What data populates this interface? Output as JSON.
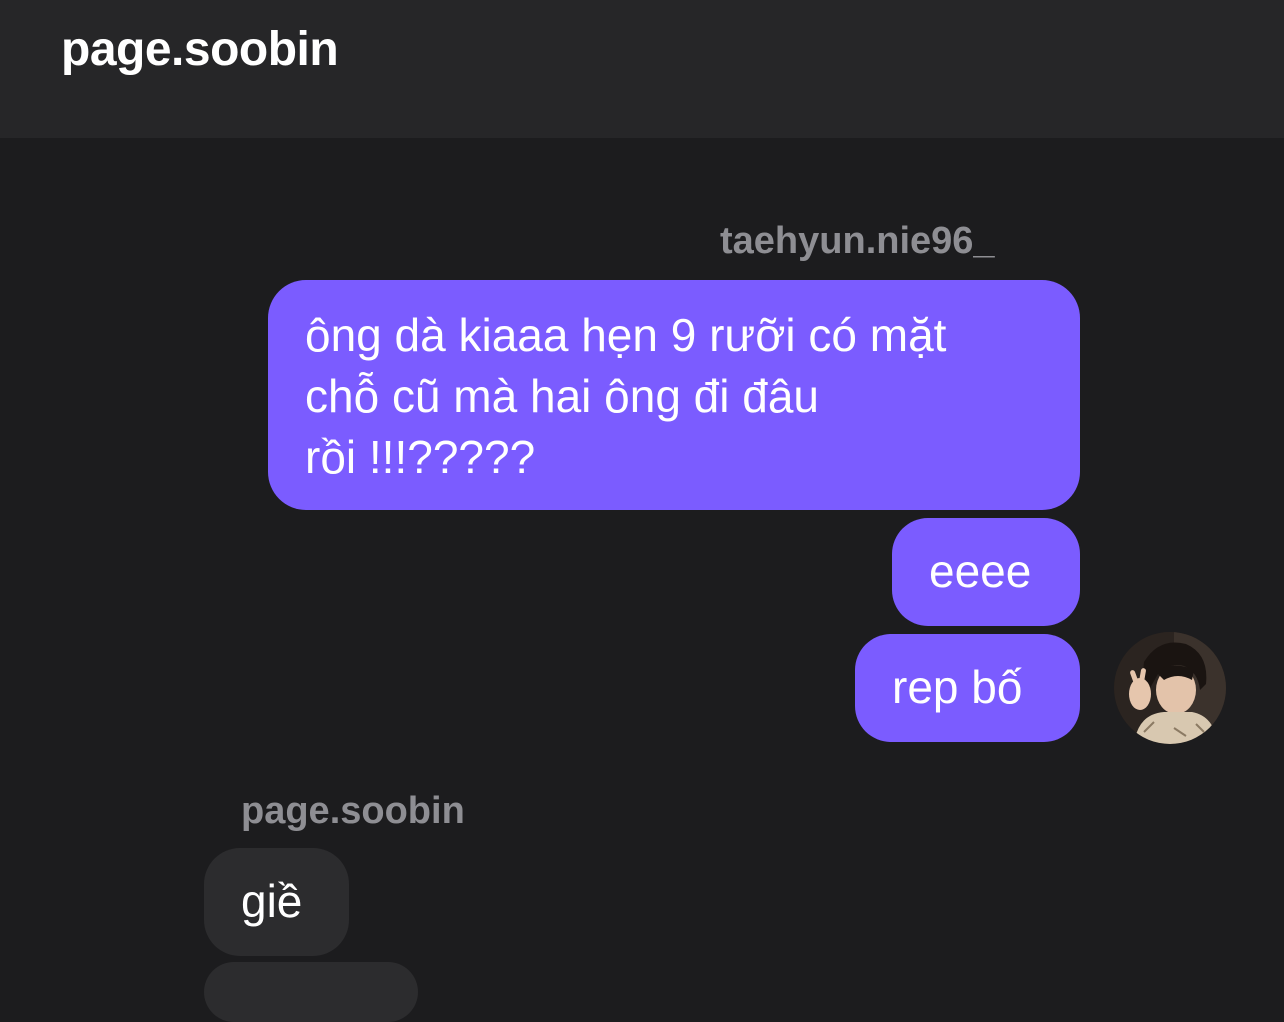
{
  "header": {
    "title": "page.soobin"
  },
  "thread": {
    "groups": [
      {
        "sender": "taehyun.nie96_",
        "direction": "outgoing",
        "messages": [
          {
            "lines": [
              "ông dà kiaaa hẹn 9 rưỡi có mặt",
              "chỗ cũ mà hai ông đi đâu",
              "rồi !!!?????"
            ]
          },
          {
            "lines": [
              "eeee"
            ]
          },
          {
            "lines": [
              "rep bố"
            ]
          }
        ],
        "avatar": "user-avatar-photo"
      },
      {
        "sender": "page.soobin",
        "direction": "incoming",
        "messages": [
          {
            "lines": [
              "giề"
            ]
          }
        ]
      }
    ]
  },
  "colors": {
    "outgoing_bubble": "#7b5cff",
    "incoming_bubble": "#2c2c2e",
    "background": "#1c1c1e",
    "header": "#262628",
    "sender_name": "#8e8e93"
  }
}
